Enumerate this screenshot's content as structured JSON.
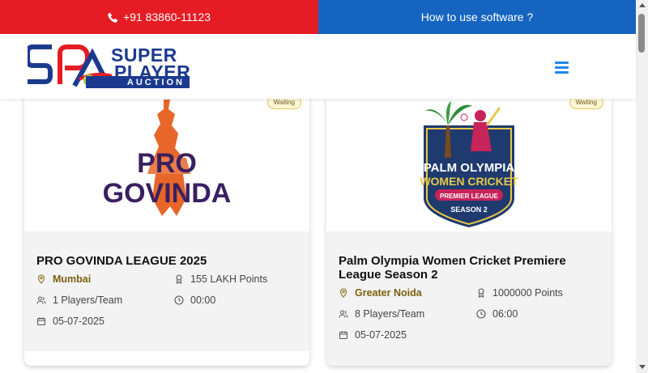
{
  "topbar": {
    "phone": "+91 83860-11123",
    "howto": "How to use software ?",
    "colors": {
      "phone_bg": "#e51c23",
      "howto_bg": "#1565c0"
    }
  },
  "header": {
    "logo": {
      "line1": "SUPER",
      "line2": "PLAYER",
      "line3": "AUCTION",
      "mark": "SPA"
    }
  },
  "auctions": [
    {
      "status": "Waiting",
      "image_text": [
        "PRO",
        "GOVINDA"
      ],
      "title": "PRO GOVINDA LEAGUE 2025",
      "location": "Mumbai",
      "points": "155 LAKH Points",
      "players": "1 Players/Team",
      "time": "00:00",
      "date": "05-07-2025"
    },
    {
      "status": "Waiting",
      "image_text": [
        "PALM OLYMPIA",
        "WOMEN CRICKET",
        "PREMIER LEAGUE",
        "SEASON 2"
      ],
      "title": "Palm Olympia Women Cricket Premiere League Season 2",
      "location": "Greater Noida",
      "points": "1000000 Points",
      "players": "8 Players/Team",
      "time": "06:00",
      "date": "05-07-2025"
    }
  ]
}
